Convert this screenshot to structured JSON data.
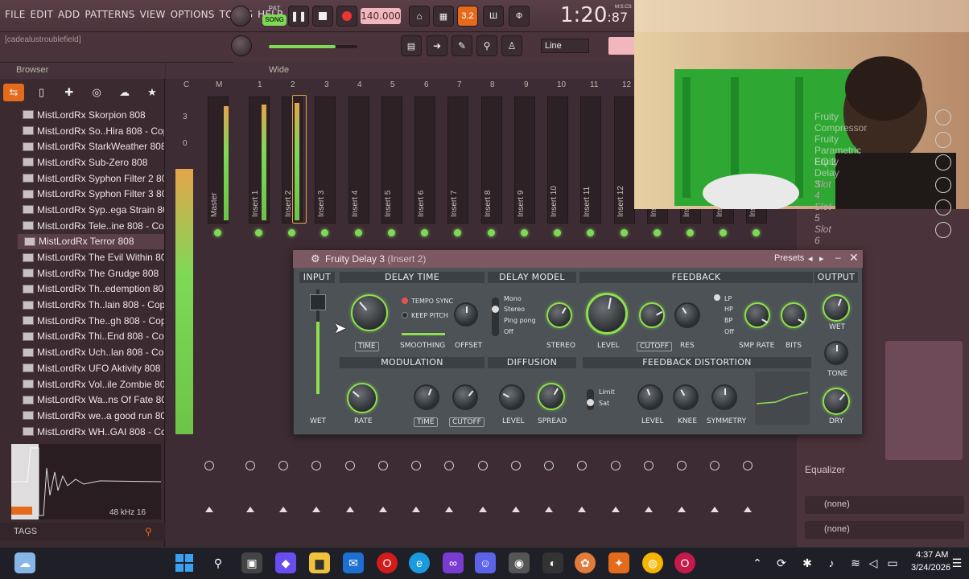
{
  "menu": [
    "FILE",
    "EDIT",
    "ADD",
    "PATTERNS",
    "VIEW",
    "OPTIONS",
    "TOOLS",
    "HELP"
  ],
  "hint": "[cadealustroublefield]",
  "transport": {
    "mode_pat": "PAT",
    "mode_song": "SONG",
    "tempo": "140.000",
    "time_main": "1:20",
    "time_sub": "87",
    "time_unit": "M:S:CS",
    "snap": "Line"
  },
  "browser": {
    "title": "Browser",
    "mixer_mode": "Wide",
    "files": [
      "MistLordRx Skorpion 808",
      "MistLordRx So..Hira 808 - Copy",
      "MistLordRx StarkWeather 808",
      "MistLordRx Sub-Zero 808",
      "MistLordRx Syphon Filter 2 808",
      "MistLordRx Syphon Filter 3 808",
      "MistLordRx Syp..ega Strain 808",
      "MistLordRx Tele..ine 808 - Copy",
      "MistLordRx Terror 808",
      "MistLordRx The Evil Within 808",
      "MistLordRx The Grudge 808",
      "MistLordRx Th..edemption 808",
      "MistLordRx Th..lain 808 - Copy",
      "MistLordRx The..gh 808 - Copy",
      "MistLordRx Thi..End 808 - Copy",
      "MistLordRx Uch..lan 808 - Copy",
      "MistLordRx UFO Aktivity 808",
      "MistLordRx Vol..ile Zombie 808",
      "MistLordRx Wa..ns Of Fate 808",
      "MistLordRx we..a good run 808",
      "MistLordRx WH..GAI 808 - Copy"
    ],
    "selected_index": 8,
    "sample_info": "48 kHz 16",
    "tags": "TAGS"
  },
  "mixer": {
    "track_numbers": [
      "C",
      "M",
      "1",
      "2",
      "3",
      "4",
      "5",
      "6",
      "7",
      "8",
      "9",
      "10",
      "11",
      "12"
    ],
    "strips": [
      "Master",
      "Insert 1",
      "Insert 2",
      "Insert 3",
      "Insert 4",
      "Insert 5",
      "Insert 6",
      "Insert 7",
      "Insert 8",
      "Insert 9",
      "Insert 10",
      "Insert 11",
      "Insert 12",
      "Ins",
      "Ins",
      "Ins",
      "Ins"
    ],
    "scale": [
      "3",
      "0"
    ]
  },
  "effects_slots": [
    "Fruity Compressor",
    "Fruity Parametric EQ 2",
    "Fruity Delay 3",
    "Slot 4",
    "Slot 5",
    "Slot 6"
  ],
  "equalizer_label": "Equalizer",
  "routing": [
    "(none)",
    "(none)"
  ],
  "plugin": {
    "title": "Fruity Delay 3",
    "insert": "(Insert 2)",
    "presets": "Presets",
    "sections": {
      "input": "INPUT",
      "delay_time": "DELAY TIME",
      "delay_model": "DELAY MODEL",
      "feedback": "FEEDBACK",
      "output": "OUTPUT",
      "modulation": "MODULATION",
      "diffusion": "DIFFUSION",
      "feedback_distortion": "FEEDBACK DISTORTION"
    },
    "tempo_sync": "TEMPO SYNC",
    "keep_pitch": "KEEP PITCH",
    "models": [
      "Mono",
      "Stereo",
      "Ping pong",
      "Off"
    ],
    "filters": [
      "LP",
      "HP",
      "BP",
      "Off"
    ],
    "dist_modes": [
      "Limit",
      "Sat"
    ],
    "labels": {
      "time": "TIME",
      "smoothing": "SMOOTHING",
      "offset": "OFFSET",
      "stereo": "STEREO",
      "level": "LEVEL",
      "cutoff": "CUTOFF",
      "res": "RES",
      "smp_rate": "SMP RATE",
      "bits": "BITS",
      "wet": "WET",
      "tone": "TONE",
      "dry": "DRY",
      "input_wet": "WET",
      "rate": "RATE",
      "mod_time": "TIME",
      "mod_cutoff": "CUTOFF",
      "diff_level": "LEVEL",
      "spread": "SPREAD",
      "dist_level": "LEVEL",
      "knee": "KNEE",
      "symmetry": "SYMMETRY"
    }
  },
  "taskbar": {
    "time": "4:37 AM",
    "date": "3/24/2026"
  },
  "colors": {
    "accent_orange": "#e46a1c",
    "meter_green": "#7ed957",
    "plugin_body": "#4d5256",
    "title_pink": "#7b5862"
  }
}
